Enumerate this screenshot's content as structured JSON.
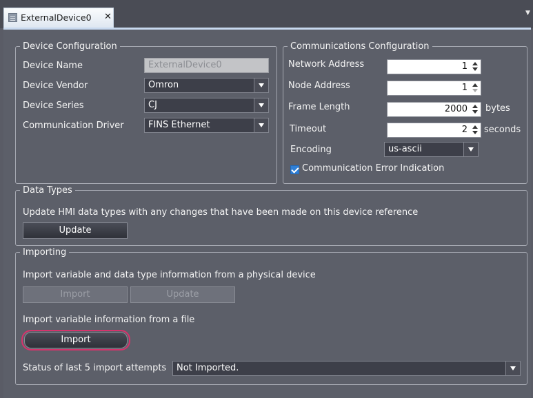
{
  "tab": {
    "title": "ExternalDevice0",
    "close": "✕"
  },
  "device_config": {
    "legend": "Device Configuration",
    "device_name_label": "Device Name",
    "device_name_value": "ExternalDevice0",
    "vendor_label": "Device Vendor",
    "vendor_value": "Omron",
    "series_label": "Device Series",
    "series_value": "CJ",
    "driver_label": "Communication Driver",
    "driver_value": "FINS Ethernet"
  },
  "comm_config": {
    "legend": "Communications Configuration",
    "network_label": "Network Address",
    "network_value": "1",
    "node_label": "Node Address",
    "node_value": "1",
    "frame_label": "Frame Length",
    "frame_value": "2000",
    "frame_unit": "bytes",
    "timeout_label": "Timeout",
    "timeout_value": "2",
    "timeout_unit": "seconds",
    "encoding_label": "Encoding",
    "encoding_value": "us-ascii",
    "error_indication_label": "Communication Error Indication",
    "error_indication_checked": true
  },
  "data_types": {
    "legend": "Data Types",
    "description": "Update HMI data types with any changes that have been made on this device reference",
    "update_label": "Update"
  },
  "importing": {
    "legend": "Importing",
    "physical_description": "Import variable and data type information from a physical device",
    "physical_import_label": "Import",
    "physical_update_label": "Update",
    "file_description": "Import variable information from a file",
    "file_import_label": "Import",
    "status_label": "Status of last 5 import attempts",
    "status_value": "Not Imported."
  },
  "colors": {
    "highlight": "#d6336c",
    "checkbox": "#2f7fd6",
    "tab_accent": "#c8d9ef"
  }
}
